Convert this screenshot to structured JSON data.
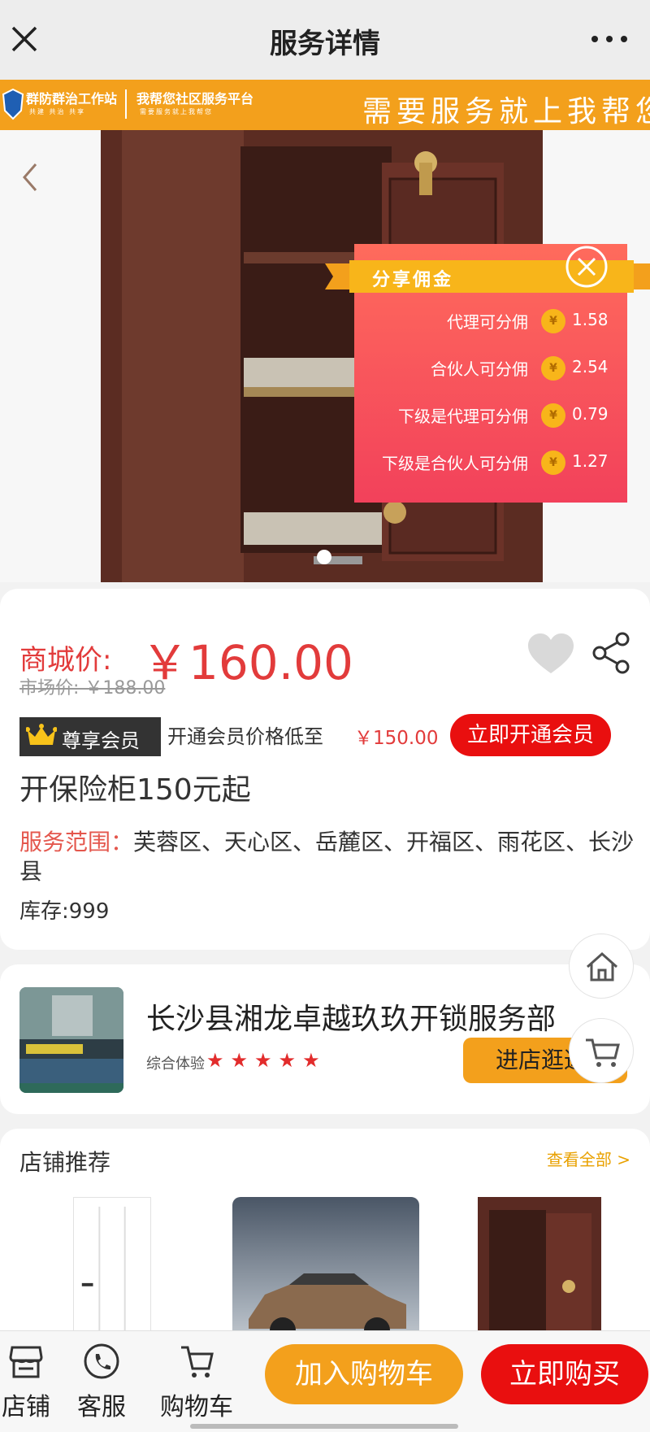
{
  "header": {
    "title": "服务详情"
  },
  "banner": {
    "station": "群防群治工作站",
    "station_sub": "共建 共治 共享",
    "platform": "我帮您社区服务平台",
    "platform_sub": "需要服务就上我帮您",
    "slogan": "需要服务就上我帮您"
  },
  "commission": {
    "title": "分享佣金",
    "currency_symbol": "¥",
    "rows": [
      {
        "label": "代理可分佣",
        "amount": "1.58"
      },
      {
        "label": "合伙人可分佣",
        "amount": "2.54"
      },
      {
        "label": "下级是代理可分佣",
        "amount": "0.79"
      },
      {
        "label": "下级是合伙人可分佣",
        "amount": "1.27"
      }
    ]
  },
  "product": {
    "price_label": "商城价:",
    "price": "￥160.00",
    "market_price": "市场价: ￥188.00",
    "vip_badge": "尊享会员",
    "vip_desc": "开通会员价格低至",
    "vip_price": "￥150.00",
    "vip_button": "立即开通会员",
    "name": "开保险柜150元起",
    "scope_label": "服务范围：",
    "scope_value": "芙蓉区、天心区、岳麓区、开福区、雨花区、长沙县",
    "stock": "库存:999"
  },
  "store": {
    "name": "长沙县湘龙卓越玖玖开锁服务部",
    "rating_label": "综合体验",
    "stars": [
      "★",
      "★",
      "★",
      "★",
      "★"
    ],
    "enter_button": "进店逛逛"
  },
  "recommend": {
    "title": "店铺推荐",
    "view_all": "查看全部 >"
  },
  "bottombar": {
    "shop": "店铺",
    "service": "客服",
    "cart": "购物车",
    "add_to_cart": "加入购物车",
    "buy_now": "立即购买"
  },
  "colors": {
    "accent_orange": "#f3a01c",
    "accent_red": "#e90f0f",
    "price_red": "#e23b3b"
  }
}
